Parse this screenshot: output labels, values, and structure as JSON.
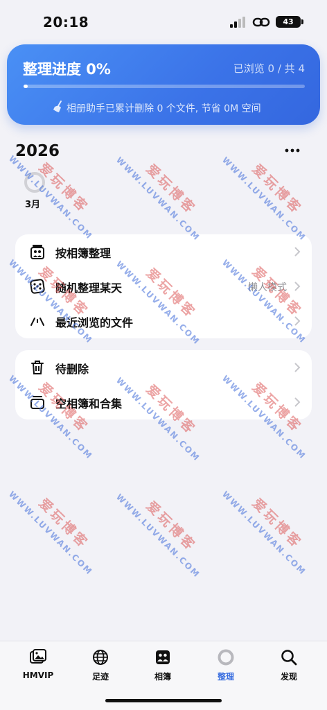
{
  "status_bar": {
    "time": "20:18",
    "battery": "43"
  },
  "progress": {
    "title": "整理进度 0%",
    "count": "已浏览 0 / 共 4",
    "fraction": 0,
    "note": "相册助手已累计删除 0 个文件, 节省 0M 空间"
  },
  "timeline": {
    "year": "2026",
    "month": "3月"
  },
  "menu_primary": [
    {
      "label": "按相簿整理",
      "value": ""
    },
    {
      "label": "随机整理某天",
      "value": "懒人模式"
    },
    {
      "label": "最近浏览的文件",
      "value": ""
    }
  ],
  "menu_secondary": [
    {
      "label": "待删除"
    },
    {
      "label": "空相簿和合集"
    }
  ],
  "watermark": {
    "cn": "爱玩博客",
    "en": "WWW.LUVWAN.COM"
  },
  "tabs": [
    {
      "label": "HMVIP",
      "icon": "photos-icon"
    },
    {
      "label": "足迹",
      "icon": "globe-icon"
    },
    {
      "label": "相簿",
      "icon": "album-icon"
    },
    {
      "label": "整理",
      "icon": "ring-icon"
    },
    {
      "label": "发现",
      "icon": "search-icon"
    }
  ],
  "colors": {
    "accent": "#3b6fe0",
    "card_start": "#4a90f5",
    "card_end": "#3467df"
  }
}
